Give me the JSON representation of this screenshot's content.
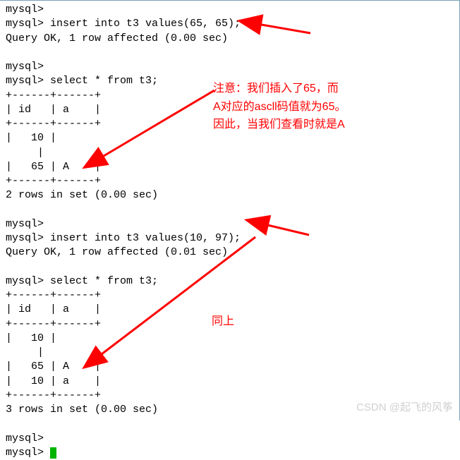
{
  "lines": {
    "l0": "mysql>",
    "l1": "mysql> insert into t3 values(65, 65);",
    "l2": "Query OK, 1 row affected (0.00 sec)",
    "l3": "",
    "l4": "mysql>",
    "l5": "mysql> select * from t3;",
    "l6": "+------+------+",
    "l7": "| id   | a    |",
    "l8": "+------+------+",
    "l9": "|   10 |",
    "l10": "     |",
    "l11": "|   65 | A    |",
    "l12": "+------+------+",
    "l13": "2 rows in set (0.00 sec)",
    "l14": "",
    "l15": "mysql>",
    "l16": "mysql> insert into t3 values(10, 97);",
    "l17": "Query OK, 1 row affected (0.01 sec)",
    "l18": "",
    "l19": "mysql> select * from t3;",
    "l20": "+------+------+",
    "l21": "| id   | a    |",
    "l22": "+------+------+",
    "l23": "|   10 |",
    "l24": "     |",
    "l25": "|   65 | A    |",
    "l26": "|   10 | a    |",
    "l27": "+------+------+",
    "l28": "3 rows in set (0.00 sec)",
    "l29": "",
    "l30": "mysql>",
    "l31": "mysql> "
  },
  "annotations": {
    "note1_l1": "注意：我们插入了65，而",
    "note1_l2": "A对应的ascll码值就为65。",
    "note1_l3": "因此，当我们查看时就是A",
    "note2": "同上"
  },
  "watermark": "CSDN @起飞的风筝"
}
